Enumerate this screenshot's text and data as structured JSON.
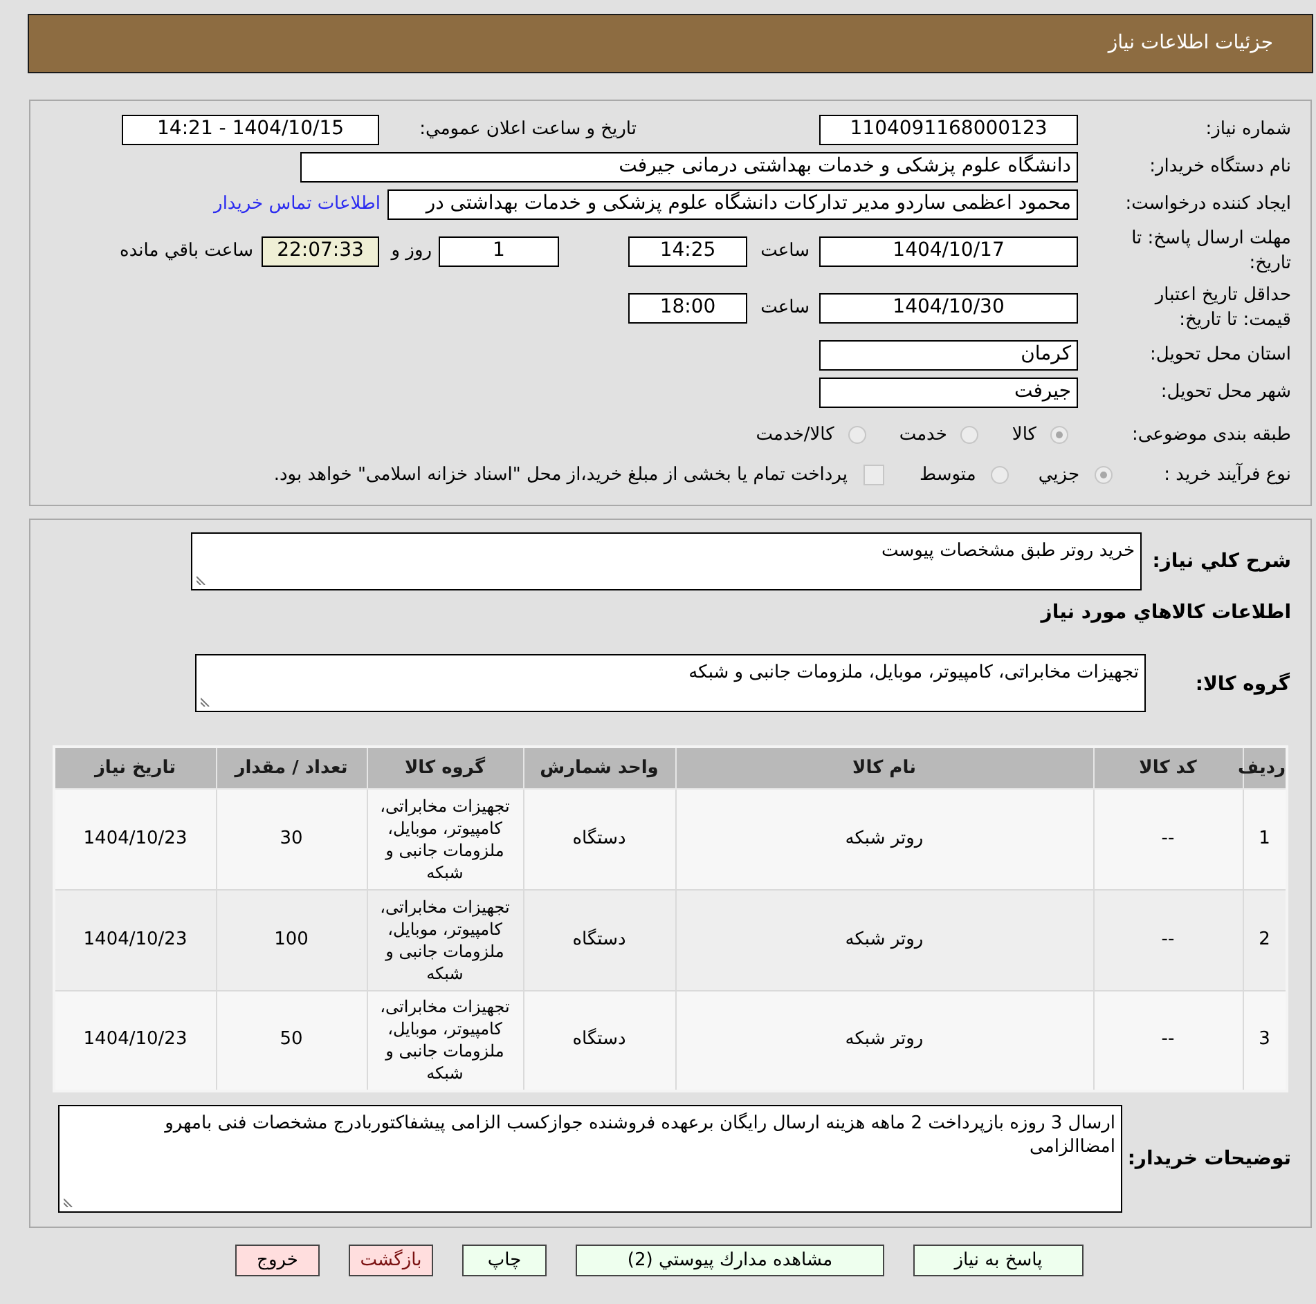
{
  "header": {
    "title": "جزئیات اطلاعات نیاز"
  },
  "details": {
    "need_number": {
      "label": "شماره نیاز:",
      "value": "1104091168000123"
    },
    "announce_datetime": {
      "label": "تاریخ و ساعت اعلان عمومي:",
      "value": "1404/10/15 - 14:21"
    },
    "buyer_org": {
      "label": "نام دستگاه خریدار:",
      "value": "دانشگاه علوم پزشکی و خدمات بهداشتی درمانی جیرفت"
    },
    "requester": {
      "label": "ایجاد کننده درخواست:",
      "value": "محمود اعظمی ساردو مدیر تدارکات دانشگاه علوم پزشکی و خدمات بهداشتی در",
      "link": "اطلاعات تماس خریدار"
    },
    "reply_deadline": {
      "label": "مهلت ارسال پاسخ: تا تاریخ:",
      "date": "1404/10/17",
      "time_label": "ساعت",
      "time": "14:25",
      "days": "1",
      "days_label": "روز و",
      "remaining": "22:07:33",
      "remaining_label": "ساعت باقي مانده"
    },
    "price_validity": {
      "label": "حداقل تاریخ اعتبار قیمت: تا تاریخ:",
      "date": "1404/10/30",
      "time_label": "ساعت",
      "time": "18:00"
    },
    "province": {
      "label": "استان محل تحویل:",
      "value": "کرمان"
    },
    "city": {
      "label": "شهر محل تحویل:",
      "value": "جیرفت"
    },
    "category": {
      "label": "طبقه بندی موضوعی:",
      "disabled": true,
      "options": [
        {
          "label": "کالا",
          "selected": true
        },
        {
          "label": "خدمت",
          "selected": false
        },
        {
          "label": "کالا/خدمت",
          "selected": false
        }
      ]
    },
    "process_type": {
      "label": "نوع فرآیند خرید :",
      "disabled": true,
      "options": [
        {
          "label": "جزيي",
          "selected": true
        },
        {
          "label": "متوسط",
          "selected": false
        }
      ],
      "treasury": {
        "checked": false,
        "text": "پرداخت تمام یا بخشی از مبلغ خرید،از محل \"اسناد خزانه اسلامی\" خواهد بود."
      }
    }
  },
  "summary": {
    "label": "شرح کلي نیاز:",
    "value": "خرید روتر طبق مشخصات پیوست"
  },
  "goods_heading": "اطلاعات کالاهاي مورد نیاز",
  "goods_group": {
    "label": "گروه کالا:",
    "value": "تجهیزات مخابراتی، کامپیوتر، موبایل، ملزومات جانبی و شبکه"
  },
  "table": {
    "columns": [
      "ردیف",
      "کد کالا",
      "نام کالا",
      "واحد شمارش",
      "گروه کالا",
      "تعداد / مقدار",
      "تاریخ نیاز"
    ],
    "rows": [
      [
        "1",
        "--",
        "روتر شبکه",
        "دستگاه",
        "تجهیزات مخابراتی، کامپیوتر، موبایل، ملزومات جانبی و شبکه",
        "30",
        "1404/10/23"
      ],
      [
        "2",
        "--",
        "روتر شبکه",
        "دستگاه",
        "تجهیزات مخابراتی، کامپیوتر، موبایل، ملزومات جانبی و شبکه",
        "100",
        "1404/10/23"
      ],
      [
        "3",
        "--",
        "روتر شبکه",
        "دستگاه",
        "تجهیزات مخابراتی، کامپیوتر، موبایل، ملزومات جانبی و شبکه",
        "50",
        "1404/10/23"
      ]
    ]
  },
  "buyer_notes": {
    "label": "توضیحات خریدار:",
    "value": "ارسال 3 روزه بازپرداخت 2 ماهه هزینه ارسال رایگان برعهده فروشنده جوازکسب الزامی پیشفاکتوربادرج مشخصات فنی بامهرو امضاالزامی"
  },
  "buttons": [
    {
      "label": "پاسخ به نیاز",
      "kind": "normal"
    },
    {
      "label": "مشاهده مدارك پیوستي (2)",
      "kind": "normal"
    },
    {
      "label": "چاپ",
      "kind": "normal"
    },
    {
      "label": "بازگشت",
      "kind": "back"
    },
    {
      "label": "خروج",
      "kind": "exit"
    }
  ]
}
